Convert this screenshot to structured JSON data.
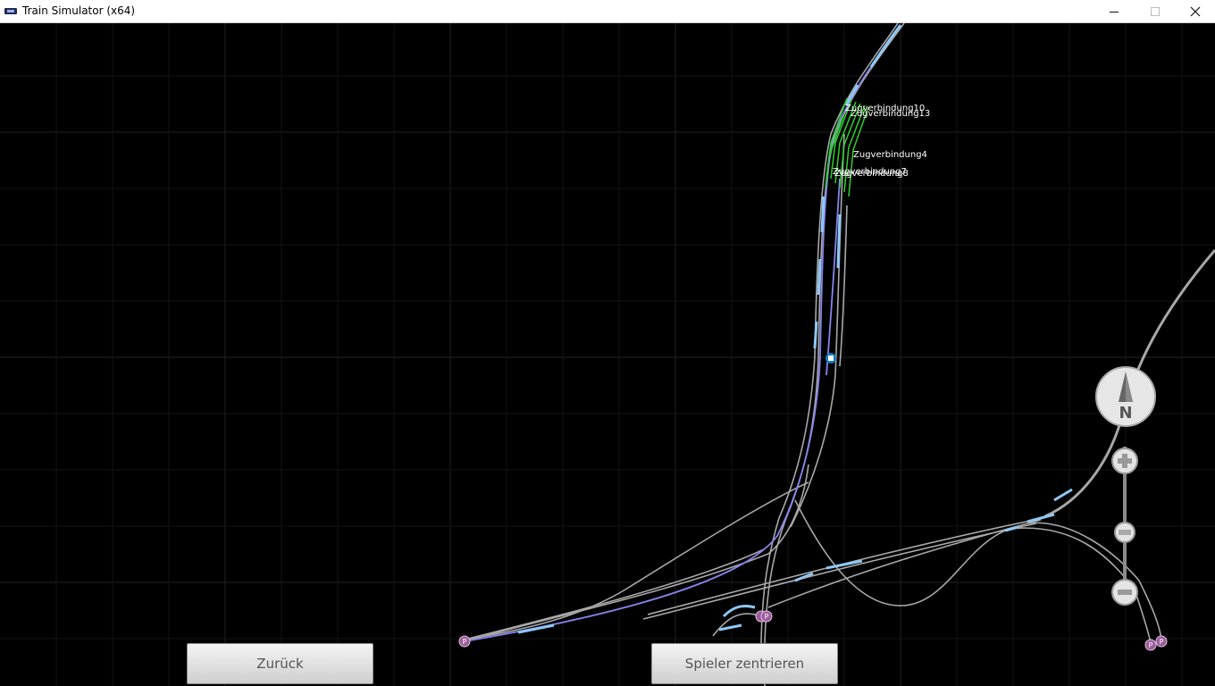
{
  "window": {
    "title": "Train Simulator (x64)",
    "app_icon": "ts-app-icon",
    "controls": [
      "minimize-icon",
      "maximize-icon",
      "close-icon"
    ]
  },
  "map": {
    "background": "#000000",
    "grid_color": "#2a2a2a",
    "track_color": "#a8a8a8",
    "signal_color": "#8fc8f5",
    "route_color": "#8585ee",
    "platform_color": "#2ed02e",
    "markers": {
      "portal_label": "P",
      "player_icon": "player-train-icon"
    },
    "labels": [
      "Zugverbindung10",
      "Zugverbindung13",
      "Zugverbindung4",
      "Zugverbindung7",
      "Zugverbindung8"
    ]
  },
  "compass": {
    "north_label": "N"
  },
  "zoom": {
    "in_icon": "plus-icon",
    "out_icon": "minus-icon",
    "level": 0.28
  },
  "buttons": {
    "back_label": "Zurück",
    "center_label": "Spieler zentrieren"
  }
}
